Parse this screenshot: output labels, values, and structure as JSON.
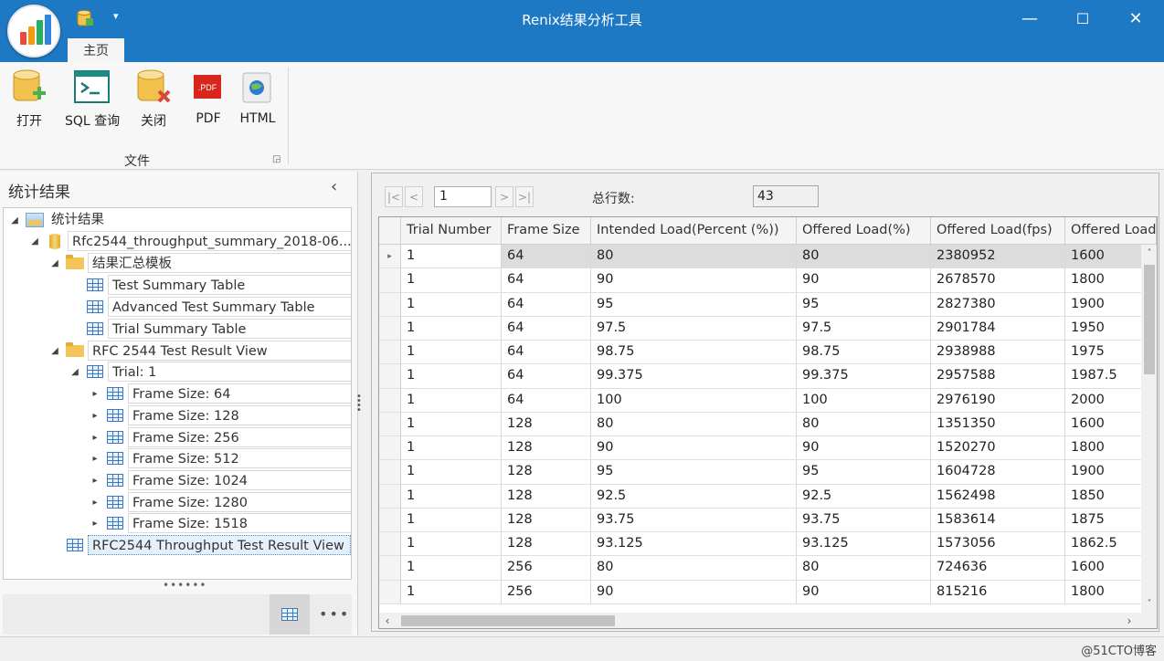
{
  "app": {
    "title": "Renix结果分析工具",
    "tab_home": "主页"
  },
  "window_controls": {
    "minimize": "—",
    "maximize": "☐",
    "close": "✕"
  },
  "ribbon": {
    "buttons": [
      {
        "label": "打开",
        "icon": "open-db-icon"
      },
      {
        "label": "SQL 查询",
        "icon": "terminal-icon"
      },
      {
        "label": "关闭",
        "icon": "close-db-icon"
      },
      {
        "label": "PDF",
        "icon": "pdf-icon",
        "icon_text": ".PDF"
      },
      {
        "label": "HTML",
        "icon": "html-globe-icon"
      }
    ],
    "group_label": "文件"
  },
  "left_panel": {
    "title": "统计结果",
    "tree": [
      {
        "label": "统计结果",
        "level": 0,
        "icon": "root-icon",
        "expanded": true
      },
      {
        "label": "Rfc2544_throughput_summary_2018-06...",
        "level": 1,
        "icon": "db-icon",
        "expanded": true
      },
      {
        "label": "结果汇总模板",
        "level": 2,
        "icon": "folder-icon",
        "expanded": true
      },
      {
        "label": "Test Summary Table",
        "level": 3,
        "icon": "table-icon"
      },
      {
        "label": "Advanced Test Summary Table",
        "level": 3,
        "icon": "table-icon"
      },
      {
        "label": "Trial Summary Table",
        "level": 3,
        "icon": "table-icon"
      },
      {
        "label": "RFC 2544 Test Result View",
        "level": 2,
        "icon": "folder-icon",
        "expanded": true
      },
      {
        "label": "Trial: 1",
        "level": 3,
        "icon": "table-icon",
        "expanded": true
      },
      {
        "label": "Frame Size: 64",
        "level": 4,
        "icon": "table-icon",
        "collapsed": true
      },
      {
        "label": "Frame Size: 128",
        "level": 4,
        "icon": "table-icon",
        "collapsed": true
      },
      {
        "label": "Frame Size: 256",
        "level": 4,
        "icon": "table-icon",
        "collapsed": true
      },
      {
        "label": "Frame Size: 512",
        "level": 4,
        "icon": "table-icon",
        "collapsed": true
      },
      {
        "label": "Frame Size: 1024",
        "level": 4,
        "icon": "table-icon",
        "collapsed": true
      },
      {
        "label": "Frame Size: 1280",
        "level": 4,
        "icon": "table-icon",
        "collapsed": true
      },
      {
        "label": "Frame Size: 1518",
        "level": 4,
        "icon": "table-icon",
        "collapsed": true
      },
      {
        "label": "RFC2544 Throughput Test Result View",
        "level": 2,
        "icon": "table-icon",
        "selected": true
      }
    ],
    "footer_more": "•••",
    "grip": "••••••"
  },
  "pager": {
    "first": "|<",
    "prev": "<",
    "page": "1",
    "next": ">",
    "last": ">|",
    "rowcount_label": "总行数:",
    "rowcount": "43"
  },
  "grid": {
    "columns": [
      "Trial Number",
      "Frame Size",
      "Intended Load(Percent (%))",
      "Offered Load(%)",
      "Offered Load(fps)",
      "Offered Load("
    ],
    "rows": [
      [
        "1",
        "64",
        "80",
        "80",
        "2380952",
        "1600"
      ],
      [
        "1",
        "64",
        "90",
        "90",
        "2678570",
        "1800"
      ],
      [
        "1",
        "64",
        "95",
        "95",
        "2827380",
        "1900"
      ],
      [
        "1",
        "64",
        "97.5",
        "97.5",
        "2901784",
        "1950"
      ],
      [
        "1",
        "64",
        "98.75",
        "98.75",
        "2938988",
        "1975"
      ],
      [
        "1",
        "64",
        "99.375",
        "99.375",
        "2957588",
        "1987.5"
      ],
      [
        "1",
        "64",
        "100",
        "100",
        "2976190",
        "2000"
      ],
      [
        "1",
        "128",
        "80",
        "80",
        "1351350",
        "1600"
      ],
      [
        "1",
        "128",
        "90",
        "90",
        "1520270",
        "1800"
      ],
      [
        "1",
        "128",
        "95",
        "95",
        "1604728",
        "1900"
      ],
      [
        "1",
        "128",
        "92.5",
        "92.5",
        "1562498",
        "1850"
      ],
      [
        "1",
        "128",
        "93.75",
        "93.75",
        "1583614",
        "1875"
      ],
      [
        "1",
        "128",
        "93.125",
        "93.125",
        "1573056",
        "1862.5"
      ],
      [
        "1",
        "256",
        "80",
        "80",
        "724636",
        "1600"
      ],
      [
        "1",
        "256",
        "90",
        "90",
        "815216",
        "1800"
      ]
    ]
  },
  "watermark": "@51CTO博客",
  "colors": {
    "title_bar": "#1e79c5",
    "ribbon_bg": "#f7f7f7",
    "selection": "#e6f0fb"
  }
}
